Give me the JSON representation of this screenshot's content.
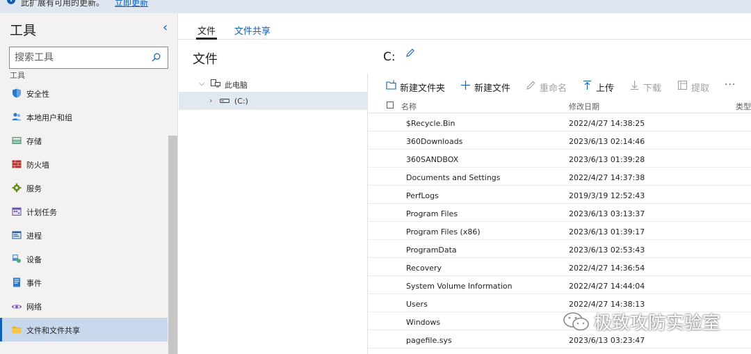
{
  "banner": {
    "message": "此扩展有可用的更新。",
    "link": "立即更新"
  },
  "sidebar": {
    "title": "工具",
    "collapse_glyph": "‹",
    "search_placeholder": "搜索工具",
    "section_label": "工具",
    "items": [
      {
        "label": "安全性",
        "icon": "shield-icon"
      },
      {
        "label": "本地用户和组",
        "icon": "users-icon"
      },
      {
        "label": "存储",
        "icon": "storage-icon"
      },
      {
        "label": "防火墙",
        "icon": "firewall-icon"
      },
      {
        "label": "服务",
        "icon": "gear-icon"
      },
      {
        "label": "计划任务",
        "icon": "calendar-icon"
      },
      {
        "label": "进程",
        "icon": "process-icon"
      },
      {
        "label": "设备",
        "icon": "device-icon"
      },
      {
        "label": "事件",
        "icon": "event-icon"
      },
      {
        "label": "网络",
        "icon": "network-icon"
      },
      {
        "label": "文件和文件共享",
        "icon": "folder-icon",
        "active": true
      }
    ]
  },
  "tabs": [
    {
      "label": "文件",
      "active": true
    },
    {
      "label": "文件共享",
      "active": false
    }
  ],
  "tree": {
    "title": "文件",
    "nodes": [
      {
        "label": "此电脑",
        "expanded": true
      },
      {
        "label": "(C:)",
        "expanded": false,
        "selected": true
      }
    ]
  },
  "main": {
    "path": "C:",
    "toolbar": {
      "new_folder": "新建文件夹",
      "new_file": "新建文件",
      "rename": "重命名",
      "upload": "上传",
      "download": "下载",
      "extract": "提取",
      "more": "···"
    },
    "columns": {
      "name": "名称",
      "modified": "修改日期",
      "type": "类型"
    },
    "rows": [
      {
        "name": "$Recycle.Bin",
        "modified": "2022/4/27 14:38:25"
      },
      {
        "name": "360Downloads",
        "modified": "2023/6/13 02:14:46"
      },
      {
        "name": "360SANDBOX",
        "modified": "2023/6/13 01:39:28"
      },
      {
        "name": "Documents and Settings",
        "modified": "2022/4/27 14:37:38"
      },
      {
        "name": "PerfLogs",
        "modified": "2019/3/19 12:52:43"
      },
      {
        "name": "Program Files",
        "modified": "2023/6/13 03:13:37"
      },
      {
        "name": "Program Files (x86)",
        "modified": "2023/6/13 01:39:17"
      },
      {
        "name": "ProgramData",
        "modified": "2023/6/13 02:53:43"
      },
      {
        "name": "Recovery",
        "modified": "2022/4/27 14:36:54"
      },
      {
        "name": "System Volume Information",
        "modified": "2022/4/27 14:44:04"
      },
      {
        "name": "Users",
        "modified": "2022/4/27 14:38:13"
      },
      {
        "name": "Windows",
        "modified": ""
      },
      {
        "name": "pagefile.sys",
        "modified": "2023/6/13 03:23:47"
      }
    ]
  },
  "watermark": {
    "text": "极致攻防实验室"
  },
  "colors": {
    "accent": "#0f5fb7",
    "sidebar_bg": "#f3f2f1",
    "active_item_bg": "#c7d8ec"
  }
}
